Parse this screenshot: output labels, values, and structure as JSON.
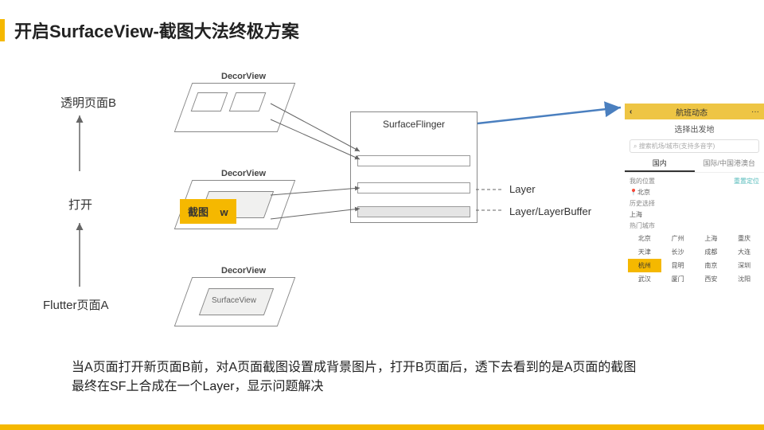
{
  "title": "开启SurfaceView-截图大法终极方案",
  "labels": {
    "pageB": "透明页面B",
    "open": "打开",
    "pageA": "Flutter页面A",
    "decor": "DecorView",
    "surfaceView": "SurfaceView",
    "screenshot": "截图",
    "surfaceFlinger": "SurfaceFlinger",
    "layer": "Layer",
    "layerBuffer": "Layer/LayerBuffer"
  },
  "description": {
    "l1": "当A页面打开新页面B前，对A页面截图设置成背景图片，打开B页面后，透下去看到的是A页面的截图",
    "l2": "最终在SF上合成在一个Layer，显示问题解决"
  },
  "phone": {
    "back": "‹",
    "title": "航班动态",
    "more": "···",
    "subtitle": "选择出发地",
    "search": "搜索机场/城市(支持多音字)",
    "tabs": [
      "国内",
      "国际/中国港澳台"
    ],
    "sec1": "我的位置",
    "sec1r": "重置定位",
    "loc": "北京",
    "sec2": "历史选择",
    "hist": "上海",
    "sec3": "热门城市",
    "cities": [
      "北京",
      "广州",
      "上海",
      "重庆",
      "天津",
      "长沙",
      "成都",
      "大连",
      "杭州",
      "昆明",
      "南京",
      "深圳",
      "武汉",
      "厦门",
      "西安",
      "沈阳"
    ]
  }
}
